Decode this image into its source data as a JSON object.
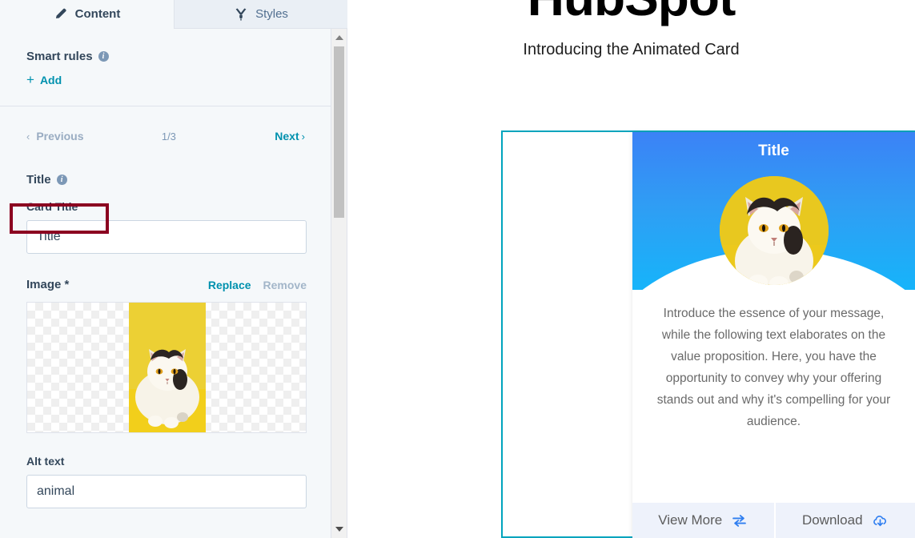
{
  "editor": {
    "tabs": [
      {
        "label": "Content",
        "icon": "pencil-icon",
        "active": true
      },
      {
        "label": "Styles",
        "icon": "paintbrush-icon",
        "active": false
      }
    ],
    "smart_rules": {
      "label": "Smart rules",
      "info_glyph": "i",
      "add_label": "Add",
      "plus_glyph": "+"
    },
    "pager": {
      "previous_label": "Previous",
      "next_label": "Next",
      "page_indicator": "1/3",
      "prev_chevron": "‹",
      "next_chevron": "›"
    },
    "fields": {
      "group_label": "Title",
      "group_info_glyph": "i",
      "card_title": {
        "label": "Card Title",
        "value": "",
        "placeholder": "Title"
      },
      "image": {
        "label": "Image *",
        "replace_label": "Replace",
        "remove_label": "Remove"
      },
      "alt_text": {
        "label": "Alt text",
        "value": "animal",
        "placeholder": "animal"
      }
    },
    "scrollbar": {
      "up_arrow": "▲",
      "down_arrow": "▼"
    }
  },
  "preview": {
    "page_heading": "HubSpot",
    "page_subheading": "Introducing the Animated Card",
    "card": {
      "title": "Title",
      "body": "Introduce the essence of your message, while the following text elaborates on the value proposition. Here, you have the opportunity to convey why your offering stands out and why it's compelling for your audience.",
      "buttons": [
        {
          "label": "View More",
          "icon": "swap-arrows-icon"
        },
        {
          "label": "Download",
          "icon": "cloud-download-icon"
        }
      ]
    }
  },
  "colors": {
    "highlight": "#8b0020",
    "accent_teal": "#00a4bd",
    "link": "#0091ae",
    "panel_bg": "#f5f8fa",
    "card_blue_top": "#3b82f6",
    "card_blue_bottom": "#16b4fa",
    "avatar_yellow": "#e8c41c",
    "button_blue": "#2f7ef0"
  }
}
